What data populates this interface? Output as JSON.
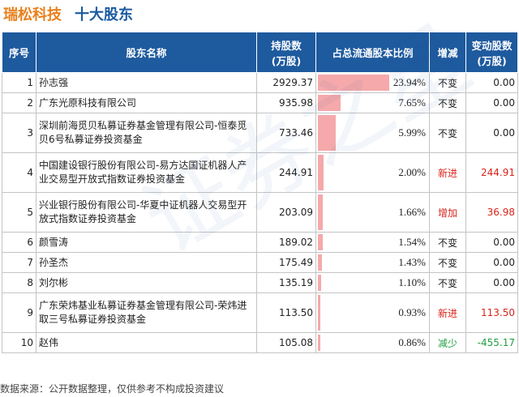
{
  "header": {
    "company": "瑞松科技",
    "subtitle": "十大股东"
  },
  "columns": {
    "rank": "序号",
    "name": "股东名称",
    "shares_line1": "持股数",
    "shares_line2": "(万股)",
    "ratio": "占总流通股本比例",
    "change": "增减",
    "delta_line1": "变动股数",
    "delta_line2": "(万股)"
  },
  "rows": [
    {
      "rank": "1",
      "name": "孙志强",
      "shares": "2929.37",
      "ratio_text": "23.94%",
      "ratio": 23.94,
      "change": "不变",
      "delta": "0.00"
    },
    {
      "rank": "2",
      "name": "广东光原科技有限公司",
      "shares": "935.98",
      "ratio_text": "7.65%",
      "ratio": 7.65,
      "change": "不变",
      "delta": "0.00"
    },
    {
      "rank": "3",
      "name": "深圳前海觅贝私募证券基金管理有限公司-恒泰觅贝6号私募证券投资基金",
      "shares": "733.46",
      "ratio_text": "5.99%",
      "ratio": 5.99,
      "change": "不变",
      "delta": "0.00"
    },
    {
      "rank": "4",
      "name": "中国建设银行股份有限公司-易方达国证机器人产业交易型开放式指数证券投资基金",
      "shares": "244.91",
      "ratio_text": "2.00%",
      "ratio": 2.0,
      "change": "新进",
      "delta": "244.91"
    },
    {
      "rank": "5",
      "name": "兴业银行股份有限公司-华夏中证机器人交易型开放式指数证券投资基金",
      "shares": "203.09",
      "ratio_text": "1.66%",
      "ratio": 1.66,
      "change": "增加",
      "delta": "36.98"
    },
    {
      "rank": "6",
      "name": "颜雪涛",
      "shares": "189.02",
      "ratio_text": "1.54%",
      "ratio": 1.54,
      "change": "不变",
      "delta": "0.00"
    },
    {
      "rank": "7",
      "name": "孙圣杰",
      "shares": "175.49",
      "ratio_text": "1.43%",
      "ratio": 1.43,
      "change": "不变",
      "delta": "0.00"
    },
    {
      "rank": "8",
      "name": "刘尔彬",
      "shares": "135.19",
      "ratio_text": "1.10%",
      "ratio": 1.1,
      "change": "不变",
      "delta": "0.00"
    },
    {
      "rank": "9",
      "name": "广东荣炜基业私募证券基金管理有限公司-荣炜进取三号私募证券投资基金",
      "shares": "113.50",
      "ratio_text": "0.93%",
      "ratio": 0.93,
      "change": "新进",
      "delta": "113.50"
    },
    {
      "rank": "10",
      "name": "赵伟",
      "shares": "105.08",
      "ratio_text": "0.86%",
      "ratio": 0.86,
      "change": "减少",
      "delta": "-455.17"
    }
  ],
  "change_colors": {
    "不变": "#222222",
    "新进": "#d9241b",
    "增加": "#d9241b",
    "减少": "#20a040"
  },
  "bar_color": "#f5a9ab",
  "header_color": "#1e5a9e",
  "watermark": "证券之星",
  "footer": "数据来源：公开数据整理，仅供参考不构成投资建议"
}
